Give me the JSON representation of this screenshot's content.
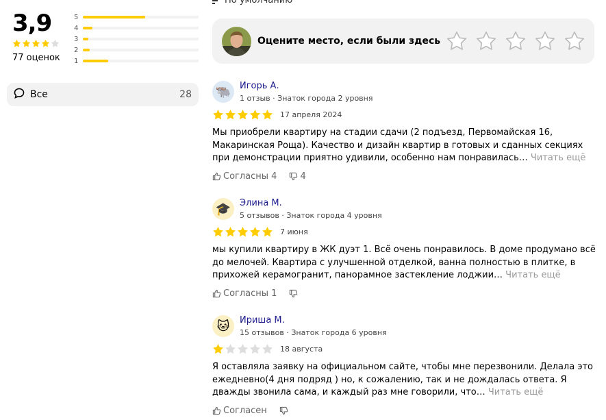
{
  "summary": {
    "rating": "3,9",
    "stars_value": 4,
    "count": "77 оценок",
    "distribution": [
      {
        "label": "5",
        "fraction": 0.54
      },
      {
        "label": "4",
        "fraction": 0.08
      },
      {
        "label": "3",
        "fraction": 0.05
      },
      {
        "label": "2",
        "fraction": 0.06
      },
      {
        "label": "1",
        "fraction": 0.22
      }
    ]
  },
  "filter": {
    "label": "Все",
    "count": "28"
  },
  "sort": {
    "label": "По умолчанию"
  },
  "rate_prompt": {
    "text": "Оцените место, если были здесь"
  },
  "reviews": [
    {
      "name": "Игорь А.",
      "stats": "1 отзыв · Знаток города 2 уровня",
      "avatar_icon": "🐃",
      "avatar_bg": "#dde8f5",
      "stars": 5,
      "date": "17 апреля 2024",
      "text": "Мы приобрели квартиру на стадии сдачи (2 подъезд, Первомайская 16, Макаринская Роща). Качество и дизайн квартир в готовых и сданных секциях при демонстрации приятно удивили, особенно нам понравилась…",
      "more": "Читать ещё",
      "agree": "Согласны 4",
      "disagree": "4"
    },
    {
      "name": "Элина М.",
      "stats": "5 отзывов · Знаток города 4 уровня",
      "avatar_icon": "🎓",
      "avatar_bg": "#fbefc4",
      "stars": 5,
      "date": "7 июня",
      "text": "мы купили квартиру в ЖК дуэт 1. Всё очень понравилось. В доме продумано всё до мелочей. Квартира с улучшенной отделкой, ванна полностью в плитке, в прихожей керамогранит, панорамное застекление лоджии…",
      "more": "Читать ещё",
      "agree": "Согласны 1",
      "disagree": ""
    },
    {
      "name": "Ириша М.",
      "stats": "15 отзывов · Знаток города 6 уровня",
      "avatar_icon": "🐱",
      "avatar_bg": "#fbefc4",
      "stars": 1,
      "date": "18 августа",
      "text": "Я оставляла заявку на официальном сайте, чтобы мне перезвонили. Делала это ежедневно(4 дня подряд ) но, к сожалению, так и не дождалась ответа. Я дважды звонила сама, и каждый раз мне говорили, что…",
      "more": "Читать ещё",
      "agree": "Согласен",
      "disagree": ""
    }
  ],
  "colors": {
    "star_filled": "#fc0",
    "star_empty": "#ddd",
    "name_link": "#1a1a8c"
  }
}
